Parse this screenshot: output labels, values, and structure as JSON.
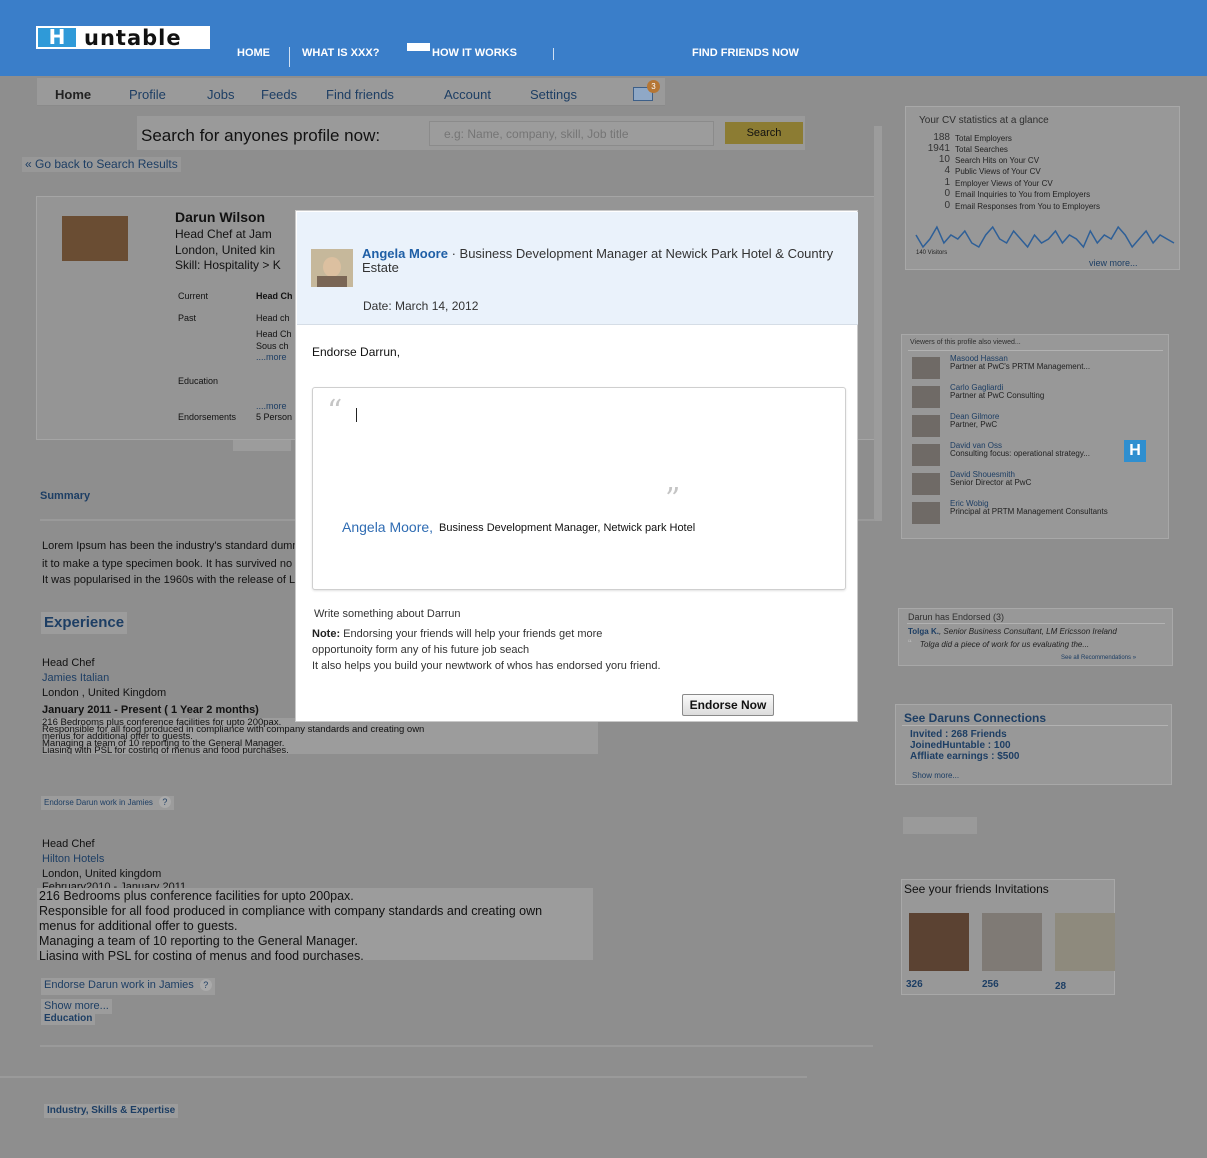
{
  "header": {
    "logo_mark": "H",
    "logo_text": "untable",
    "nav": [
      "HOME",
      "WHAT IS XXX?",
      "HOW IT WORKS",
      "FIND FRIENDS NOW"
    ]
  },
  "subnav": {
    "items": [
      "Home",
      "Profile",
      "Jobs",
      "Feeds",
      "Find friends",
      "Account",
      "Settings"
    ],
    "mail_badge": "3"
  },
  "search": {
    "label": "Search for anyones profile now:",
    "placeholder": "e.g: Name, company, skill, Job title",
    "button": "Search"
  },
  "goback": "« Go back to Search Results",
  "profile": {
    "name": "Darun Wilson",
    "title": "Head Chef at Jam",
    "location": "London, United kin",
    "skill": "Skill: Hospitality > K",
    "current_label": "Current",
    "current_value": "Head Ch",
    "past_label": "Past",
    "past_values": [
      "Head ch",
      "Head Ch",
      "Sous ch"
    ],
    "more": "....more",
    "education_label": "Education",
    "education_more": "....more",
    "endorsements_label": "Endorsements",
    "endorsements_value": "5 Person"
  },
  "summary": {
    "title": "Summary",
    "lines": [
      "Lorem Ipsum has been the industry's standard dumm",
      " it to make a type specimen book. It has survived no",
      "It was popularised in the 1960s with the release of L"
    ]
  },
  "experience": {
    "title": "Experience",
    "job1": {
      "role": "Head Chef",
      "company": "Jamies Italian",
      "location": "London , United Kingdom",
      "dates": "January 2011 - Present ( 1 Year 2 months)",
      "desc": [
        "216 Bedrooms plus conference facilities for upto 200pax.",
        "Responsible for all food produced in compliance with company standards and creating own",
        "menus for additional offer to guests.",
        "Managing a team of 10 reporting to the General Manager.",
        "Liasing with PSL for costing of menus and food purchases."
      ],
      "endorse": "Endorse Darun work in Jamies"
    },
    "job2": {
      "role": "Head Chef",
      "company": "Hilton Hotels",
      "location": "London, United kingdom",
      "dates": "February2010 - January 2011",
      "desc": [
        "216 Bedrooms plus conference facilities for upto 200pax.",
        "Responsible for all food produced in compliance with company standards and creating own",
        "menus for additional offer to guests.",
        "Managing a team of 10 reporting to the General Manager.",
        "Liasing with PSL for costing of menus and food purchases."
      ],
      "endorse": "Endorse Darun work in Jamies"
    },
    "show_more": "Show more...",
    "help": "?"
  },
  "education_title": "Education",
  "skills_title": "Industry, Skills & Expertise",
  "stats": {
    "title": "Your CV statistics at a glance",
    "rows": [
      {
        "num": "188",
        "label": "Total Employers"
      },
      {
        "num": "1941",
        "label": "Total Searches"
      },
      {
        "num": "10",
        "label": "Search Hits on Your CV"
      },
      {
        "num": "4",
        "label": "Public Views of Your CV"
      },
      {
        "num": "1",
        "label": "Employer Views of Your CV"
      },
      {
        "num": "0",
        "label": "Email Inquiries to You from Employers"
      },
      {
        "num": "0",
        "label": "Email Responses from You to Employers"
      }
    ],
    "chart_caption": "140 Visitors",
    "view_more": "view more...",
    "sparkline": [
      6,
      3,
      5,
      8,
      4,
      6,
      5,
      7,
      4,
      3,
      6,
      8,
      5,
      4,
      7,
      5,
      3,
      6,
      4,
      5,
      7,
      4,
      6,
      5,
      3,
      7,
      4,
      6,
      5,
      8,
      6,
      3,
      5,
      7,
      4,
      6,
      5,
      4
    ]
  },
  "viewers": {
    "title": "Viewers of this profile also viewed...",
    "items": [
      {
        "name": "Masood Hassan",
        "role": "Partner at PwC's PRTM Management..."
      },
      {
        "name": "Carlo Gagliardi",
        "role": "Partner at PwC Consulting"
      },
      {
        "name": "Dean Gilmore",
        "role": "Partner, PwC"
      },
      {
        "name": "David van Oss",
        "role": "Consulting focus: operational strategy..."
      },
      {
        "name": "David Shouesmith",
        "role": "Senior Director at PwC"
      },
      {
        "name": "Eric Wobig",
        "role": "Principal at PRTM Management Consultants"
      }
    ],
    "badge": "H"
  },
  "endorsed": {
    "title": "Darun has Endorsed (3)",
    "name": "Tolga K.",
    "role": ", Senior Business Consultant, LM Ericsson Ireland",
    "quote": "Tolga did a piece of work for us evaluating the...",
    "all": "See all Recommendations »"
  },
  "connections": {
    "title": "See Daruns Connections",
    "lines": [
      "Invited : 268 Friends",
      "JoinedHuntable : 100",
      "Affliate earnings : $500"
    ],
    "show_more": "Show more..."
  },
  "invitations": {
    "title": "See your friends Invitations",
    "counts": [
      "326",
      "256",
      "28"
    ]
  },
  "modal": {
    "author_name": "Angela Moore",
    "author_role": "· Business Development Manager at Newick Park Hotel & Country Estate",
    "date": "Date: March 14, 2012",
    "greeting": "Endorse Darrun,",
    "quote_open": "“",
    "quote_close": "”",
    "sig_name": "Angela Moore,",
    "sig_role": "Business Development Manager, Netwick park Hotel",
    "write": "Write something about Darrun",
    "note_label": "Note:",
    "note_line1": " Endorsing your friends will help your friends get more",
    "note_line2": "opportunoity form any of his future job seach",
    "note_line3": "It also helps you build your newtwork of whos has endorsed yoru friend.",
    "button": "Endorse Now"
  }
}
